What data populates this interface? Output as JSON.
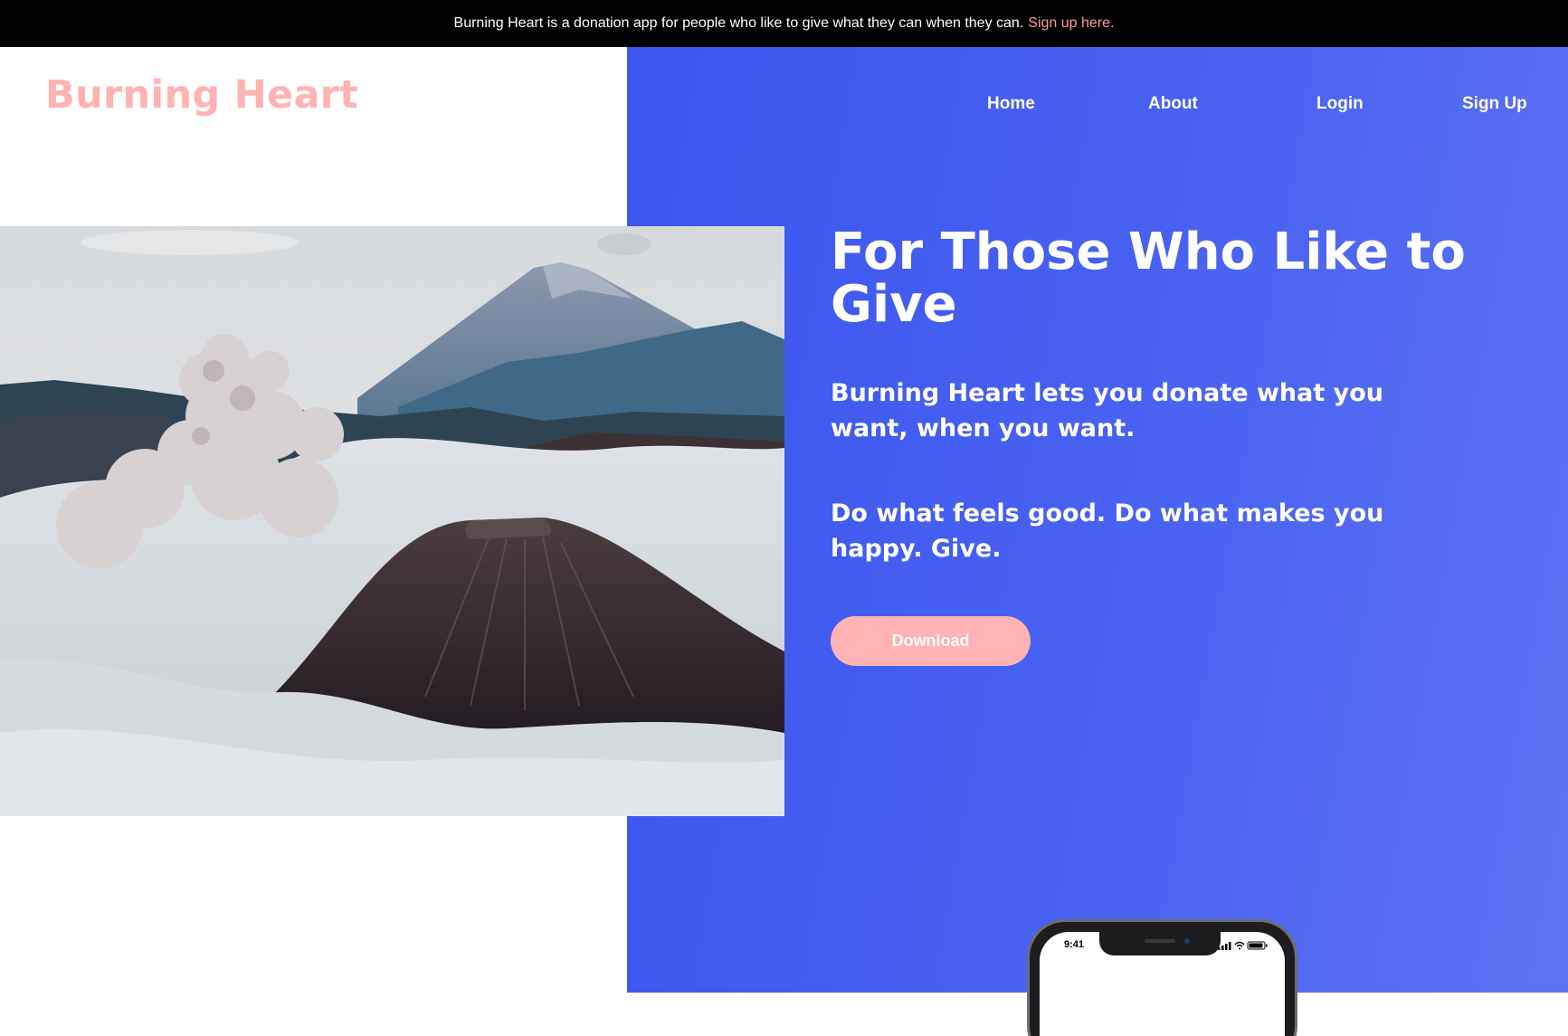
{
  "announcement": {
    "text": "Burning Heart is a donation app for people who like to give what they can when they can.",
    "link_label": "Sign up here."
  },
  "brand": {
    "logo_text": "Burning Heart"
  },
  "nav": {
    "items": [
      "Home",
      "About",
      "Login",
      "Sign Up"
    ]
  },
  "hero": {
    "headline": "For Those Who Like to Give",
    "paragraph1": "Burning Heart lets you donate what you want, when you want.",
    "paragraph2": "Do what feels good. Do what makes you happy. Give.",
    "cta_label": "Download"
  },
  "phone": {
    "time": "9:41",
    "status_icons": [
      "signal-icon",
      "wifi-icon",
      "battery-icon"
    ]
  },
  "colors": {
    "accent_pink": "#ffb3b3",
    "link_pink": "#ff9aa0",
    "panel_blue": "#3a56ef",
    "bar_black": "#000000"
  }
}
